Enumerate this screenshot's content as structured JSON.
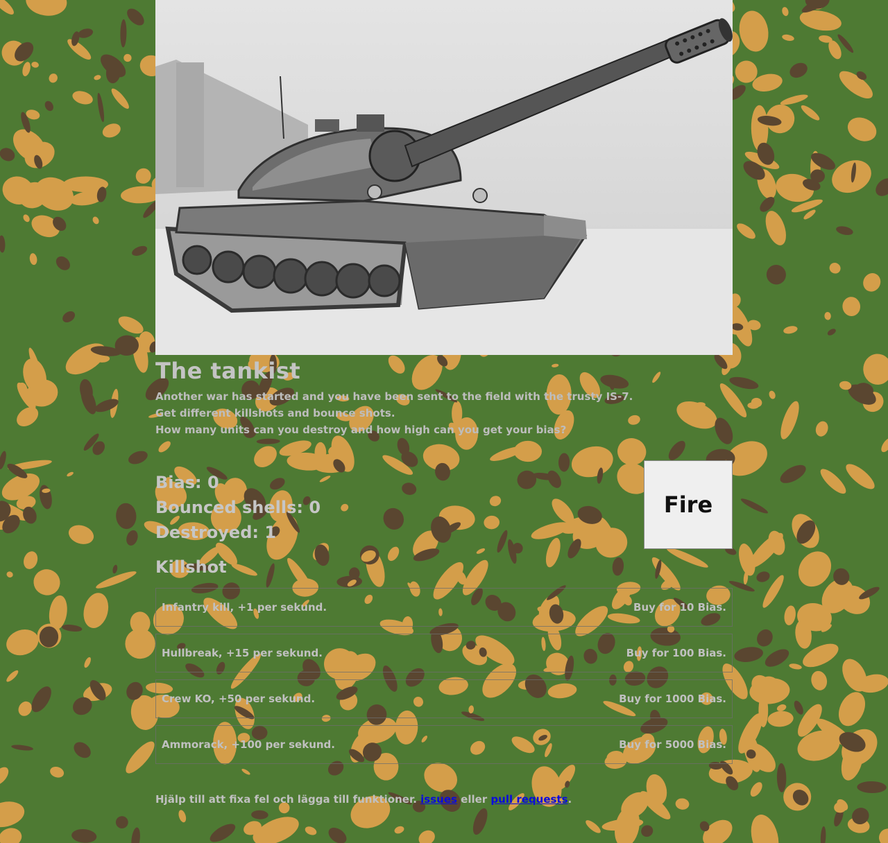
{
  "page": {
    "title": "The tankist",
    "intro": [
      "Another war has started and you have been sent to the field with the trusty IS-7.",
      "Get different killshots and bounce shots.",
      "How many units can you destroy and how high can you get your bias?"
    ]
  },
  "stats": {
    "bias": "Bias: 0",
    "bounced": "Bounced shells: 0",
    "destroyed": "Destroyed: 1"
  },
  "fire_button": {
    "label": "Fire"
  },
  "killshot": {
    "heading": "Killshot",
    "upgrades": [
      {
        "name": "Infantry kill, +1 per sekund.",
        "price": "Buy for 10 Bias."
      },
      {
        "name": "Hullbreak, +15 per sekund.",
        "price": "Buy for 100 Bias."
      },
      {
        "name": "Crew KO, +50 per sekund.",
        "price": "Buy for 1000 Bias."
      },
      {
        "name": "Ammorack, +100 per sekund.",
        "price": "Buy for 5000 Bias."
      }
    ]
  },
  "footer": {
    "text_before": "Hjälp till att fixa fel och lägga till funktioner. ",
    "link_issues": "issues",
    "text_middle": " eller ",
    "link_prs": "pull requests",
    "text_after": "."
  },
  "colors": {
    "camo_green": "#4e7a33",
    "camo_tan": "#d49e4a",
    "camo_brown": "#5a4630",
    "link": "#0b0bdc"
  }
}
